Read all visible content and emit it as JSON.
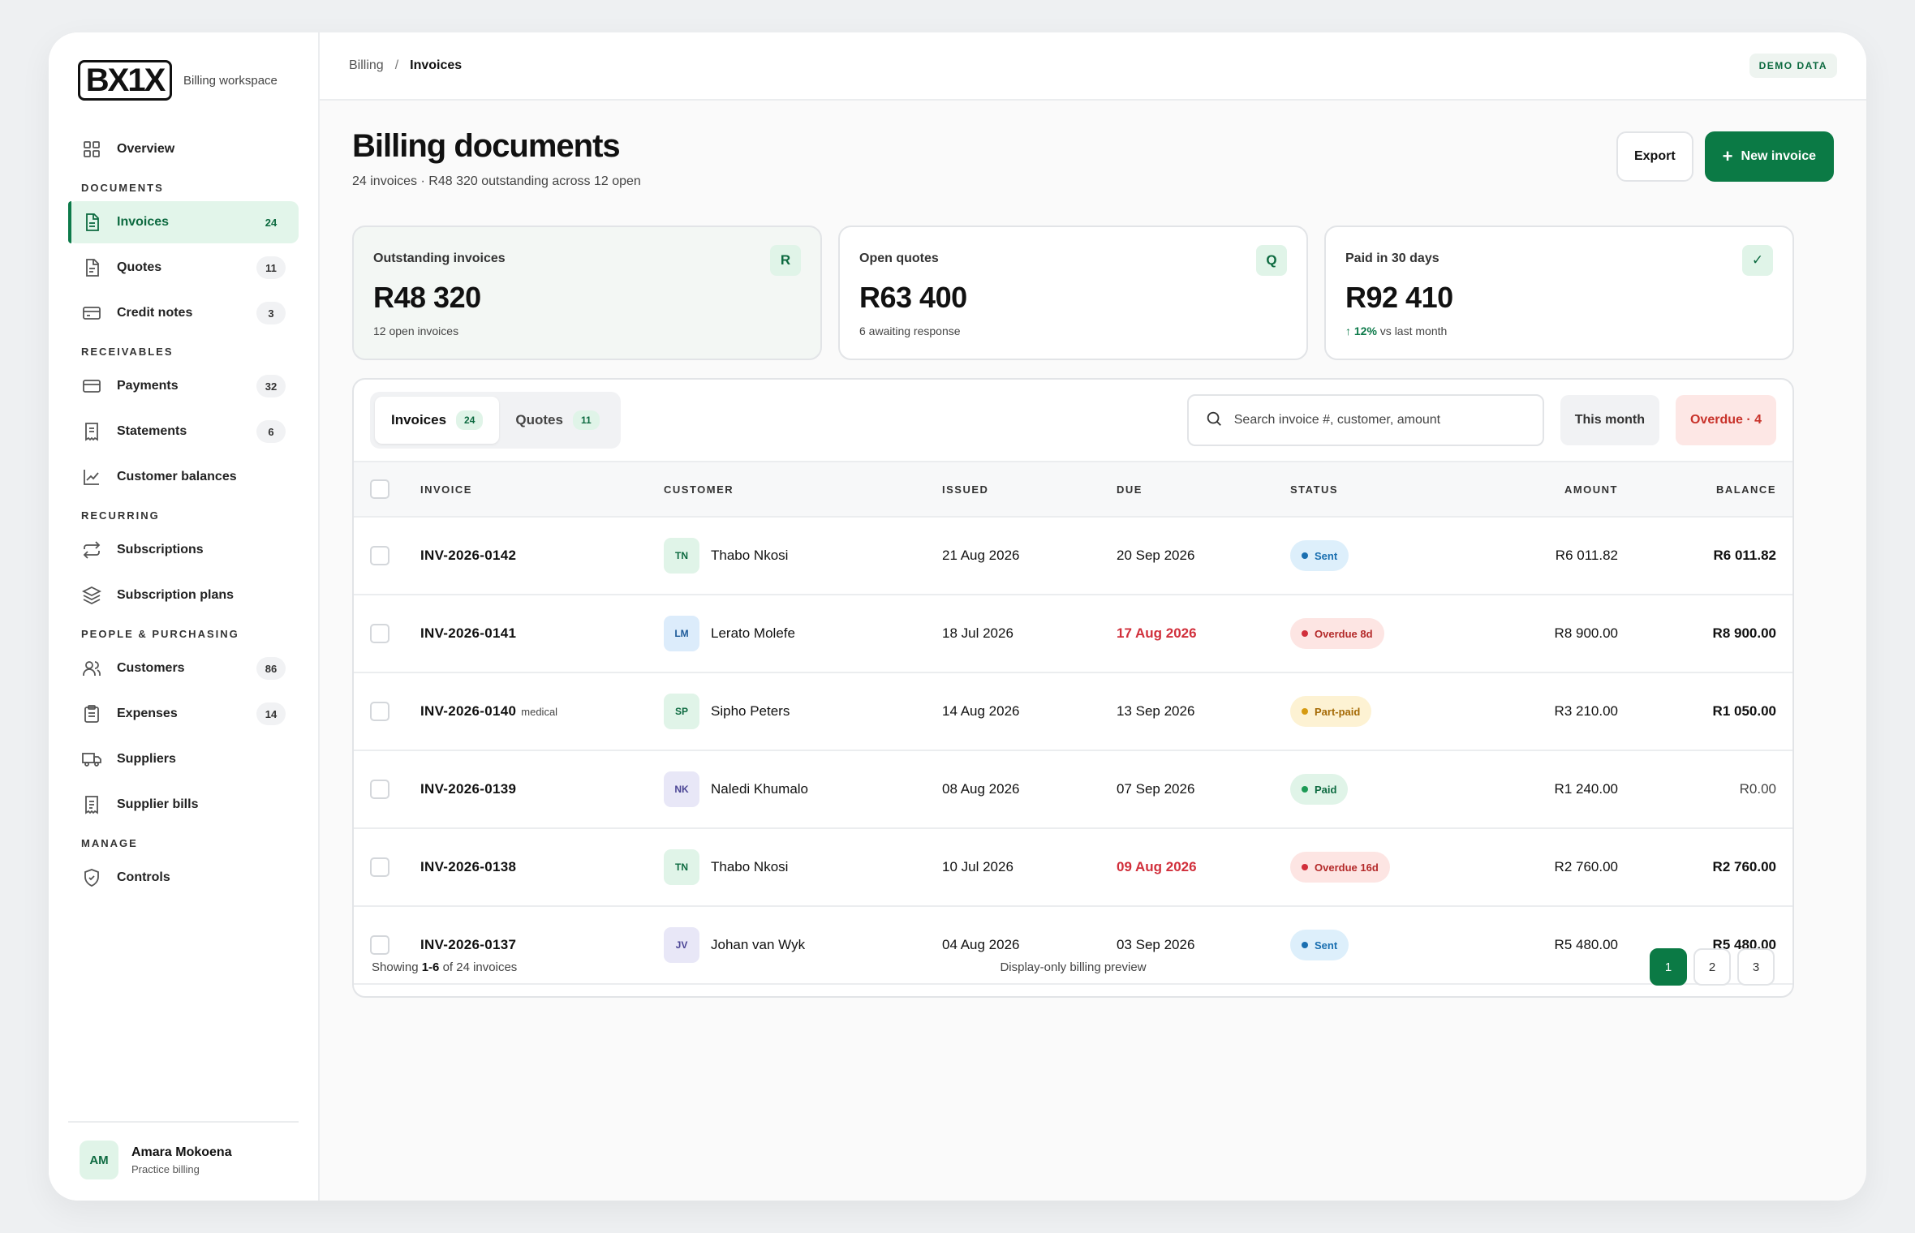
{
  "brand": {
    "logo": "BX1X",
    "subtitle": "Billing workspace"
  },
  "sidebar": {
    "overview": {
      "label": "Overview",
      "icon": "grid-icon"
    },
    "sections": {
      "documents": "DOCUMENTS",
      "receivables": "RECEIVABLES",
      "recurring": "RECURRING",
      "people": "PEOPLE & PURCHASING",
      "manage": "MANAGE"
    },
    "items": {
      "invoices": {
        "label": "Invoices",
        "count": "24",
        "icon": "document-icon"
      },
      "quotes": {
        "label": "Quotes",
        "count": "11",
        "icon": "file-icon"
      },
      "credit_notes": {
        "label": "Credit notes",
        "count": "3",
        "icon": "card-icon"
      },
      "payments": {
        "label": "Payments",
        "count": "32",
        "icon": "credit-card-icon"
      },
      "statements": {
        "label": "Statements",
        "count": "6",
        "icon": "receipt-icon"
      },
      "customer_balances": {
        "label": "Customer balances",
        "icon": "chart-icon"
      },
      "subscriptions": {
        "label": "Subscriptions",
        "icon": "repeat-icon"
      },
      "subscription_plans": {
        "label": "Subscription plans",
        "icon": "layers-icon"
      },
      "customers": {
        "label": "Customers",
        "count": "86",
        "icon": "users-icon"
      },
      "expenses": {
        "label": "Expenses",
        "count": "14",
        "icon": "clipboard-icon"
      },
      "suppliers": {
        "label": "Suppliers",
        "icon": "truck-icon"
      },
      "supplier_bills": {
        "label": "Supplier bills",
        "icon": "bill-icon"
      },
      "controls": {
        "label": "Controls",
        "icon": "shield-icon"
      }
    },
    "user": {
      "initials": "AM",
      "name": "Amara Mokoena",
      "role": "Practice billing"
    }
  },
  "topbar": {
    "crumb_root": "Billing",
    "crumb_sep": "/",
    "crumb_current": "Invoices",
    "demo": "DEMO DATA"
  },
  "header": {
    "title": "Billing documents",
    "subtitle": "24 invoices · R48 320 outstanding across 12 open",
    "export_label": "Export",
    "new_label": "New invoice"
  },
  "stats": [
    {
      "label": "Outstanding invoices",
      "value": "R48 320",
      "note": "12 open invoices",
      "badge": "R"
    },
    {
      "label": "Open quotes",
      "value": "R63 400",
      "note": "6 awaiting response",
      "badge": "Q"
    },
    {
      "label": "Paid in 30 days",
      "value": "R92 410",
      "note_up": "↑ 12%",
      "note": " vs last month",
      "badge": "✓"
    }
  ],
  "tabs": {
    "invoices": {
      "label": "Invoices",
      "count": "24"
    },
    "quotes": {
      "label": "Quotes",
      "count": "11"
    }
  },
  "search": {
    "placeholder": "Search invoice #, customer, amount"
  },
  "filters": {
    "period": "This month",
    "overdue": "Overdue · 4"
  },
  "table": {
    "headers": {
      "invoice": "INVOICE",
      "customer": "CUSTOMER",
      "issued": "ISSUED",
      "due": "DUE",
      "status": "STATUS",
      "amount": "AMOUNT",
      "balance": "BALANCE"
    },
    "rows": [
      {
        "invoice": "INV-2026-0142",
        "tag": "",
        "initials": "TN",
        "customer": "Thabo Nkosi",
        "issued": "21 Aug 2026",
        "due": "20 Sep 2026",
        "overdue": false,
        "status": "Sent",
        "status_type": "sent",
        "amount": "R6 011.82",
        "balance": "R6 011.82"
      },
      {
        "invoice": "INV-2026-0141",
        "tag": "",
        "initials": "LM",
        "customer": "Lerato Molefe",
        "issued": "18 Jul 2026",
        "due": "17 Aug 2026",
        "overdue": true,
        "status": "Overdue 8d",
        "status_type": "overdue",
        "amount": "R8 900.00",
        "balance": "R8 900.00"
      },
      {
        "invoice": "INV-2026-0140",
        "tag": "medical",
        "initials": "SP",
        "customer": "Sipho Peters",
        "issued": "14 Aug 2026",
        "due": "13 Sep 2026",
        "overdue": false,
        "status": "Part-paid",
        "status_type": "part",
        "amount": "R3 210.00",
        "balance": "R1 050.00"
      },
      {
        "invoice": "INV-2026-0139",
        "tag": "",
        "initials": "NK",
        "customer": "Naledi Khumalo",
        "issued": "08 Aug 2026",
        "due": "07 Sep 2026",
        "overdue": false,
        "status": "Paid",
        "status_type": "paid",
        "amount": "R1 240.00",
        "balance": "R0.00"
      },
      {
        "invoice": "INV-2026-0138",
        "tag": "",
        "initials": "TN",
        "customer": "Thabo Nkosi",
        "issued": "10 Jul 2026",
        "due": "09 Aug 2026",
        "overdue": true,
        "status": "Overdue 16d",
        "status_type": "overdue",
        "amount": "R2 760.00",
        "balance": "R2 760.00"
      },
      {
        "invoice": "INV-2026-0137",
        "tag": "",
        "initials": "JV",
        "customer": "Johan van Wyk",
        "issued": "04 Aug 2026",
        "due": "03 Sep 2026",
        "overdue": false,
        "status": "Sent",
        "status_type": "sent",
        "amount": "R5 480.00",
        "balance": "R5 480.00"
      }
    ]
  },
  "footer": {
    "showing_prefix": "Showing ",
    "showing_range": "1-6",
    "showing_suffix": " of 24 invoices",
    "note": "Display-only billing preview",
    "pages": [
      "1",
      "2",
      "3"
    ]
  },
  "colors": {
    "accent": "#0b7a45",
    "danger": "#d12f3b"
  }
}
